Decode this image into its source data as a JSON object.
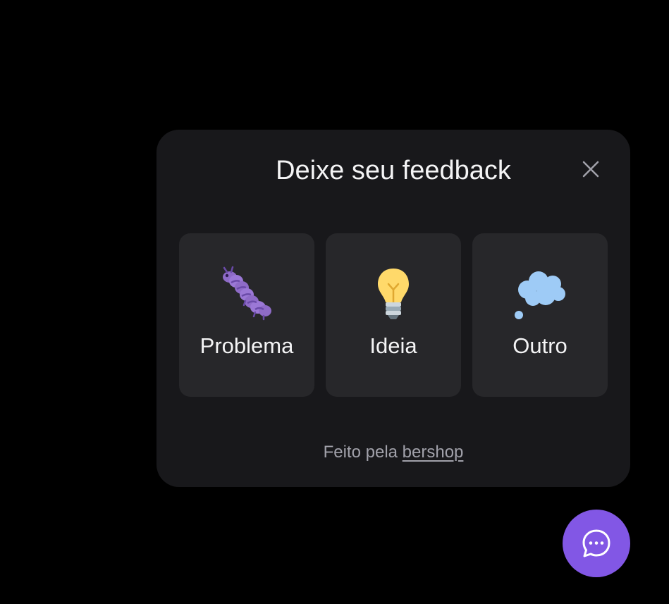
{
  "widget": {
    "title": "Deixe seu feedback",
    "close_icon": "close-icon",
    "options": [
      {
        "label": "Problema",
        "icon": "caterpillar-bug-icon"
      },
      {
        "label": "Ideia",
        "icon": "light-bulb-icon"
      },
      {
        "label": "Outro",
        "icon": "thought-balloon-icon"
      }
    ],
    "footer": {
      "prefix": "Feito pela",
      "link_text": "bershop"
    }
  },
  "fab": {
    "icon": "chat-bubble-dots-icon",
    "color": "#8257e5"
  },
  "colors": {
    "background": "#000000",
    "panel": "#18181b",
    "card": "#27272a",
    "text": "#f4f4f5",
    "muted_text": "#a1a1aa",
    "brand": "#8257e5"
  }
}
